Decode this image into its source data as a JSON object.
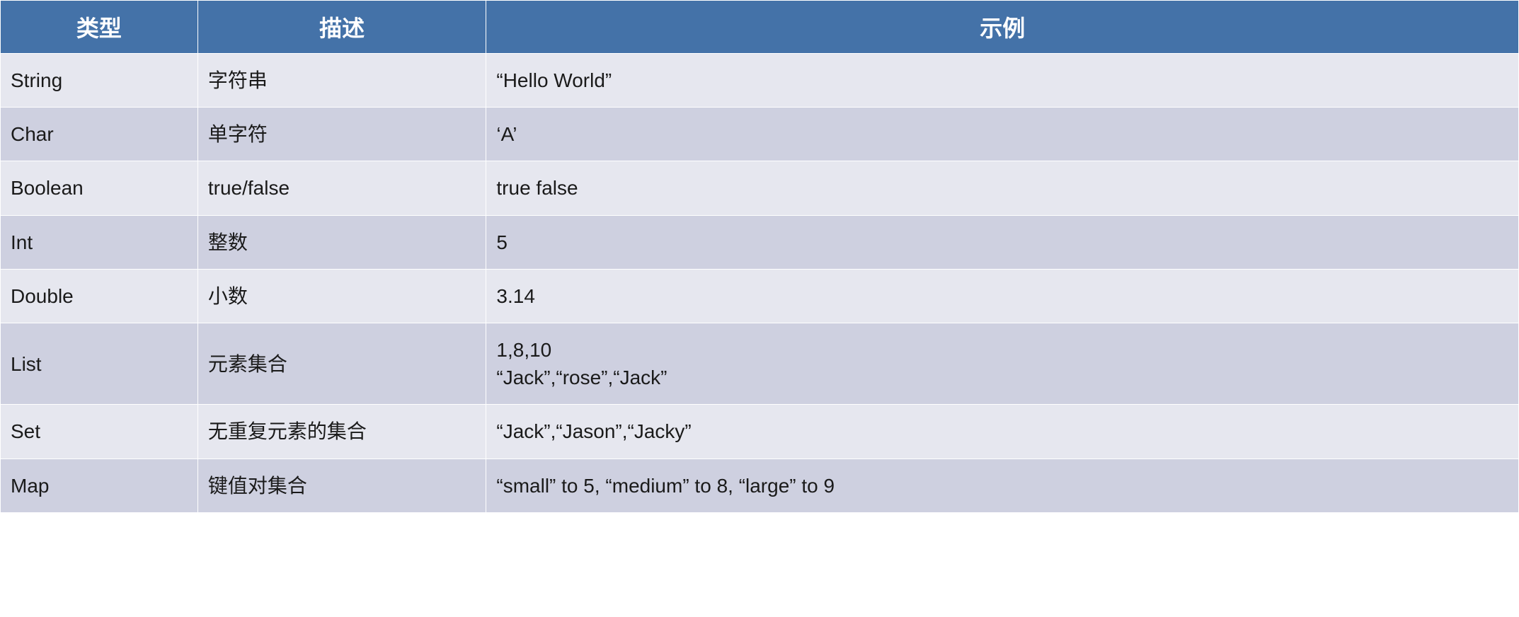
{
  "table": {
    "headers": {
      "type": "类型",
      "description": "描述",
      "example": "示例"
    },
    "rows": [
      {
        "type": "String",
        "description": "字符串",
        "example": "“Hello World”"
      },
      {
        "type": "Char",
        "description": "单字符",
        "example": "‘A’"
      },
      {
        "type": "Boolean",
        "description": "true/false",
        "example": "true false"
      },
      {
        "type": "Int",
        "description": "整数",
        "example": "5"
      },
      {
        "type": "Double",
        "description": "小数",
        "example": "3.14"
      },
      {
        "type": "List",
        "description": "元素集合",
        "example": "1,8,10\n“Jack”,“rose”,“Jack”"
      },
      {
        "type": "Set",
        "description": "无重复元素的集合",
        "example": "“Jack”,“Jason”,“Jacky”"
      },
      {
        "type": "Map",
        "description": "键值对集合",
        "example": "“small” to 5, “medium” to 8, “large” to 9"
      }
    ]
  }
}
